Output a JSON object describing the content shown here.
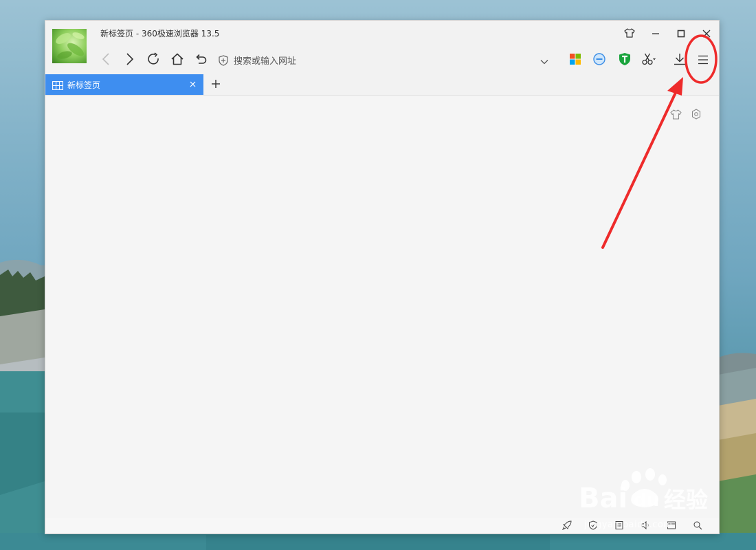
{
  "window": {
    "title": "新标签页 - 360极速浏览器 13.5"
  },
  "address_bar": {
    "placeholder": "搜索或输入网址"
  },
  "tabs": [
    {
      "label": "新标签页",
      "active": true
    }
  ],
  "watermark": {
    "brand": "Bai du 经验",
    "sub": "jingyan.baidu.com"
  },
  "colors": {
    "tab_active": "#3e8ef0",
    "annotation_red": "#ee2b2b",
    "window_bg": "#f5f5f5"
  },
  "icons": {
    "titlebar": [
      "skin-icon",
      "minimize-icon",
      "maximize-icon",
      "close-icon"
    ],
    "nav": [
      "back-icon",
      "forward-icon",
      "refresh-icon",
      "home-icon",
      "undo-icon"
    ],
    "toolbar": [
      "apps-icon",
      "ad-block-icon",
      "security-shield-icon",
      "screenshot-scissors-icon",
      "download-icon",
      "menu-icon"
    ],
    "content": [
      "skin-icon",
      "settings-icon"
    ],
    "statusbar": [
      "rocket-icon",
      "shield-icon",
      "document-icon",
      "sound-icon",
      "window-icon",
      "zoom-icon"
    ]
  }
}
